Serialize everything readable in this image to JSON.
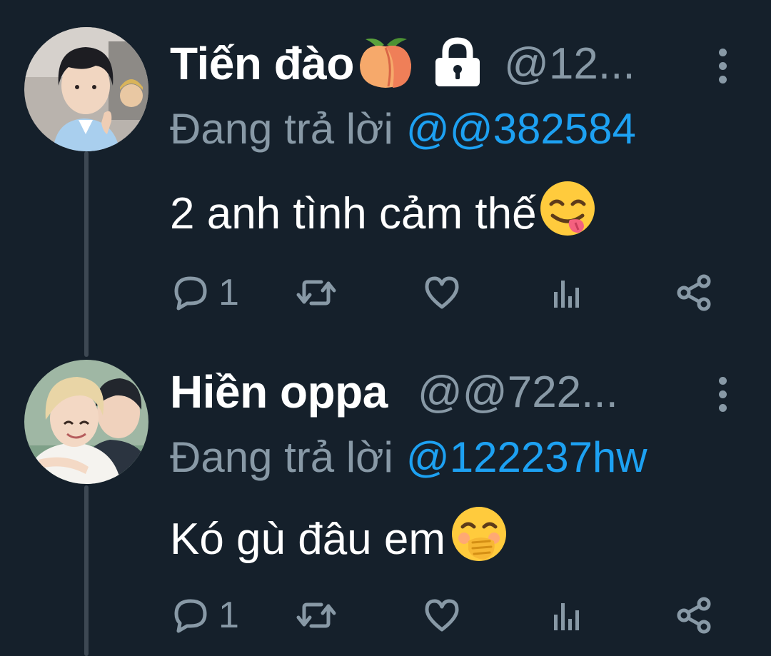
{
  "theme": {
    "background": "#15202b",
    "muted": "#8899a6",
    "link": "#1da1f2",
    "thread_line": "#3d4853"
  },
  "tweets": [
    {
      "display_name": "Tiến đào",
      "name_emojis": [
        "peach-emoji",
        "lock-icon"
      ],
      "handle": "@12...",
      "reply_prefix": "Đang trả lời",
      "reply_mention": "@@382584",
      "text": "2 anh tình cảm thế",
      "text_emoji": "face-savoring-food-emoji",
      "reply_count": "1"
    },
    {
      "display_name": "Hiền oppa",
      "name_emojis": [],
      "handle": "@@722...",
      "reply_prefix": "Đang trả lời",
      "reply_mention": "@122237hw",
      "text": "Kó gù đâu em",
      "text_emoji": "face-with-hand-over-mouth-emoji",
      "reply_count": "1"
    }
  ],
  "icons": {
    "actions": [
      "reply-icon",
      "retweet-icon",
      "like-icon",
      "stats-icon",
      "share-icon"
    ],
    "more": "more-options-icon"
  }
}
